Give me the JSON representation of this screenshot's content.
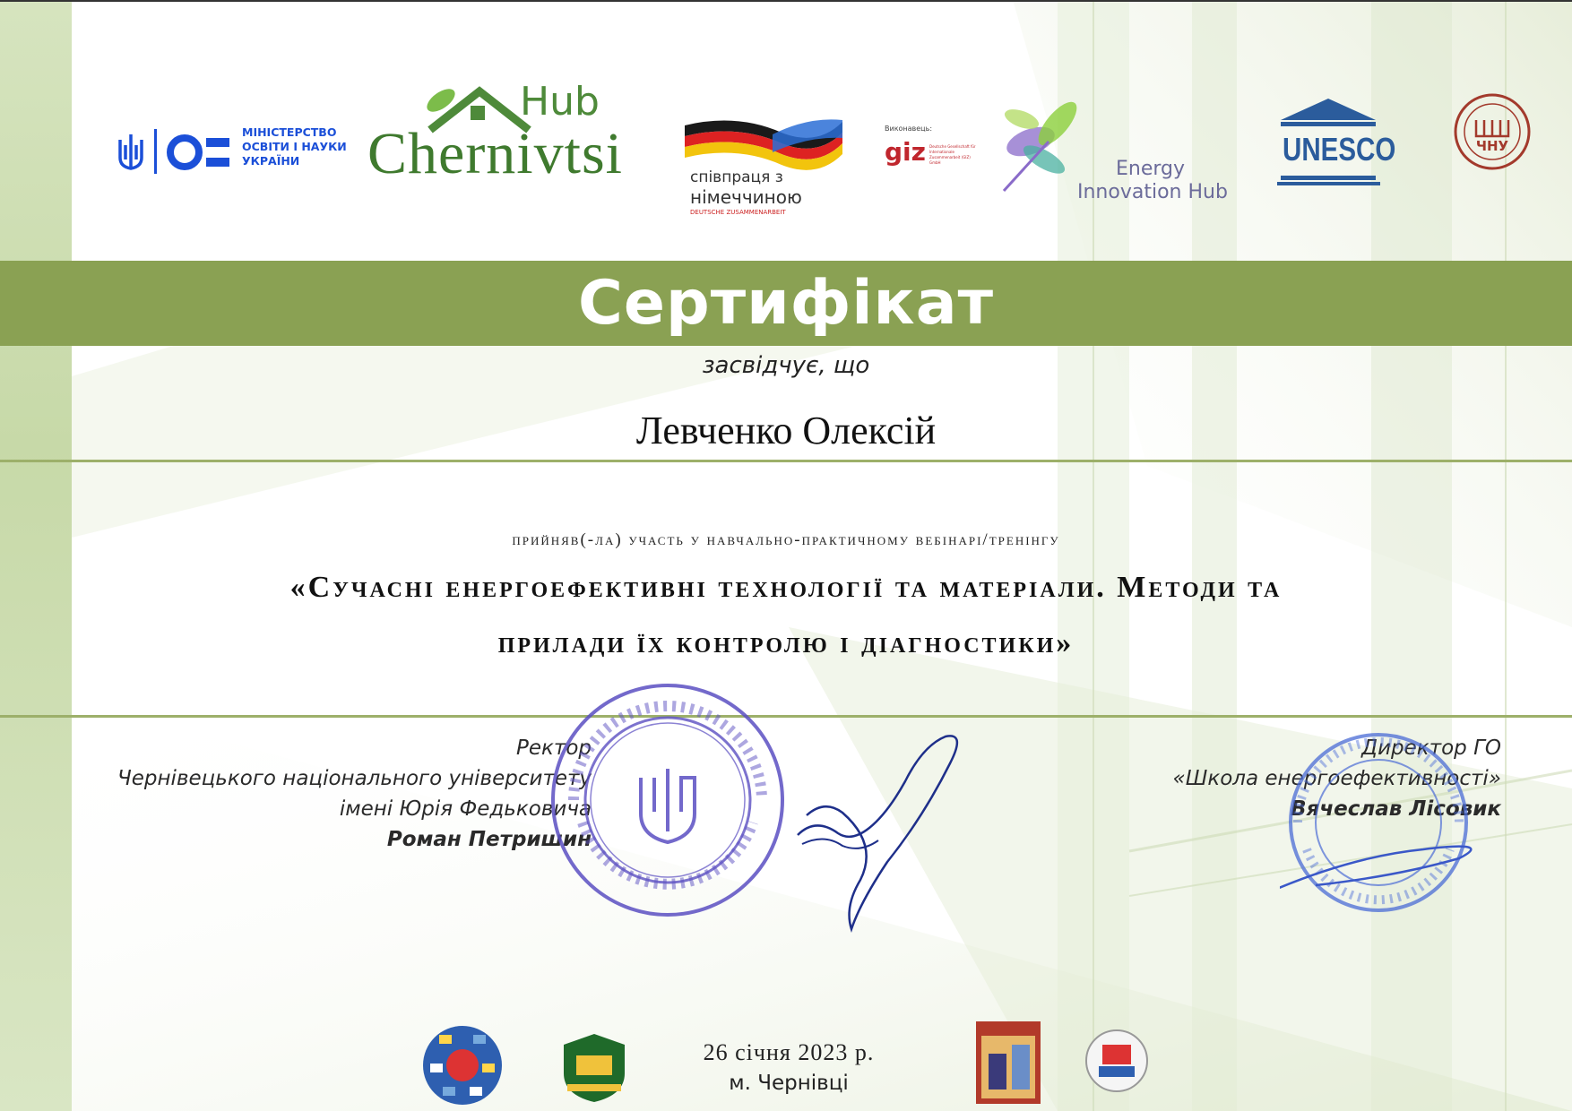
{
  "logos": {
    "ministry": {
      "lines": [
        "МІНІСТЕРСТВО",
        "ОСВІТИ І НАУКИ",
        "УКРАЇНИ"
      ],
      "icon": "trident-mon-icon"
    },
    "hub": {
      "top": "Hub",
      "main": "Chernivtsi"
    },
    "cooperation": {
      "line1": "співпраця з",
      "line2": "німеччиною",
      "line3": "DEUTSCHE ZUSAMMENARBEIT"
    },
    "giz": {
      "label": "Виконавець:",
      "mark": "giz",
      "sub": "Deutsche Gesellschaft für Internationale Zusammenarbeit (GIZ) GmbH"
    },
    "energy_hub": {
      "line1": "Energy",
      "line2": "Innovation Hub"
    },
    "unesco": {
      "label": "UNESCO"
    },
    "chnu": {
      "label": "ЧНУ"
    }
  },
  "certificate": {
    "title": "Сертифікат",
    "certifies": "засвідчує, що",
    "recipient": "Левченко Олексій",
    "participation": "прийняв(-ла) участь  у навчально-практичному вебінарі/тренінгу",
    "course_line1": "«Сучасні енергоефективні технології та матеріали. Методи та",
    "course_line2": "прилади їх контролю і діагностики»"
  },
  "signatures": {
    "left": {
      "position": "Ректор",
      "org_line1": "Чернівецького національного університету",
      "org_line2": "імені Юрія Федьковича",
      "name": "Роман Петришин"
    },
    "right": {
      "position": "Директор ГО",
      "org": "«Школа енергоефективності»",
      "name": "Вячеслав Лісовик"
    }
  },
  "footer": {
    "date": "26 січня 2023 р.",
    "city": "м. Чернівці"
  },
  "colors": {
    "band": "#8aa153",
    "line": "#9db06a",
    "ministry_blue": "#1b4fd8",
    "hub_green": "#4e8a3a",
    "stamp_blue": "#5b4fc2"
  }
}
